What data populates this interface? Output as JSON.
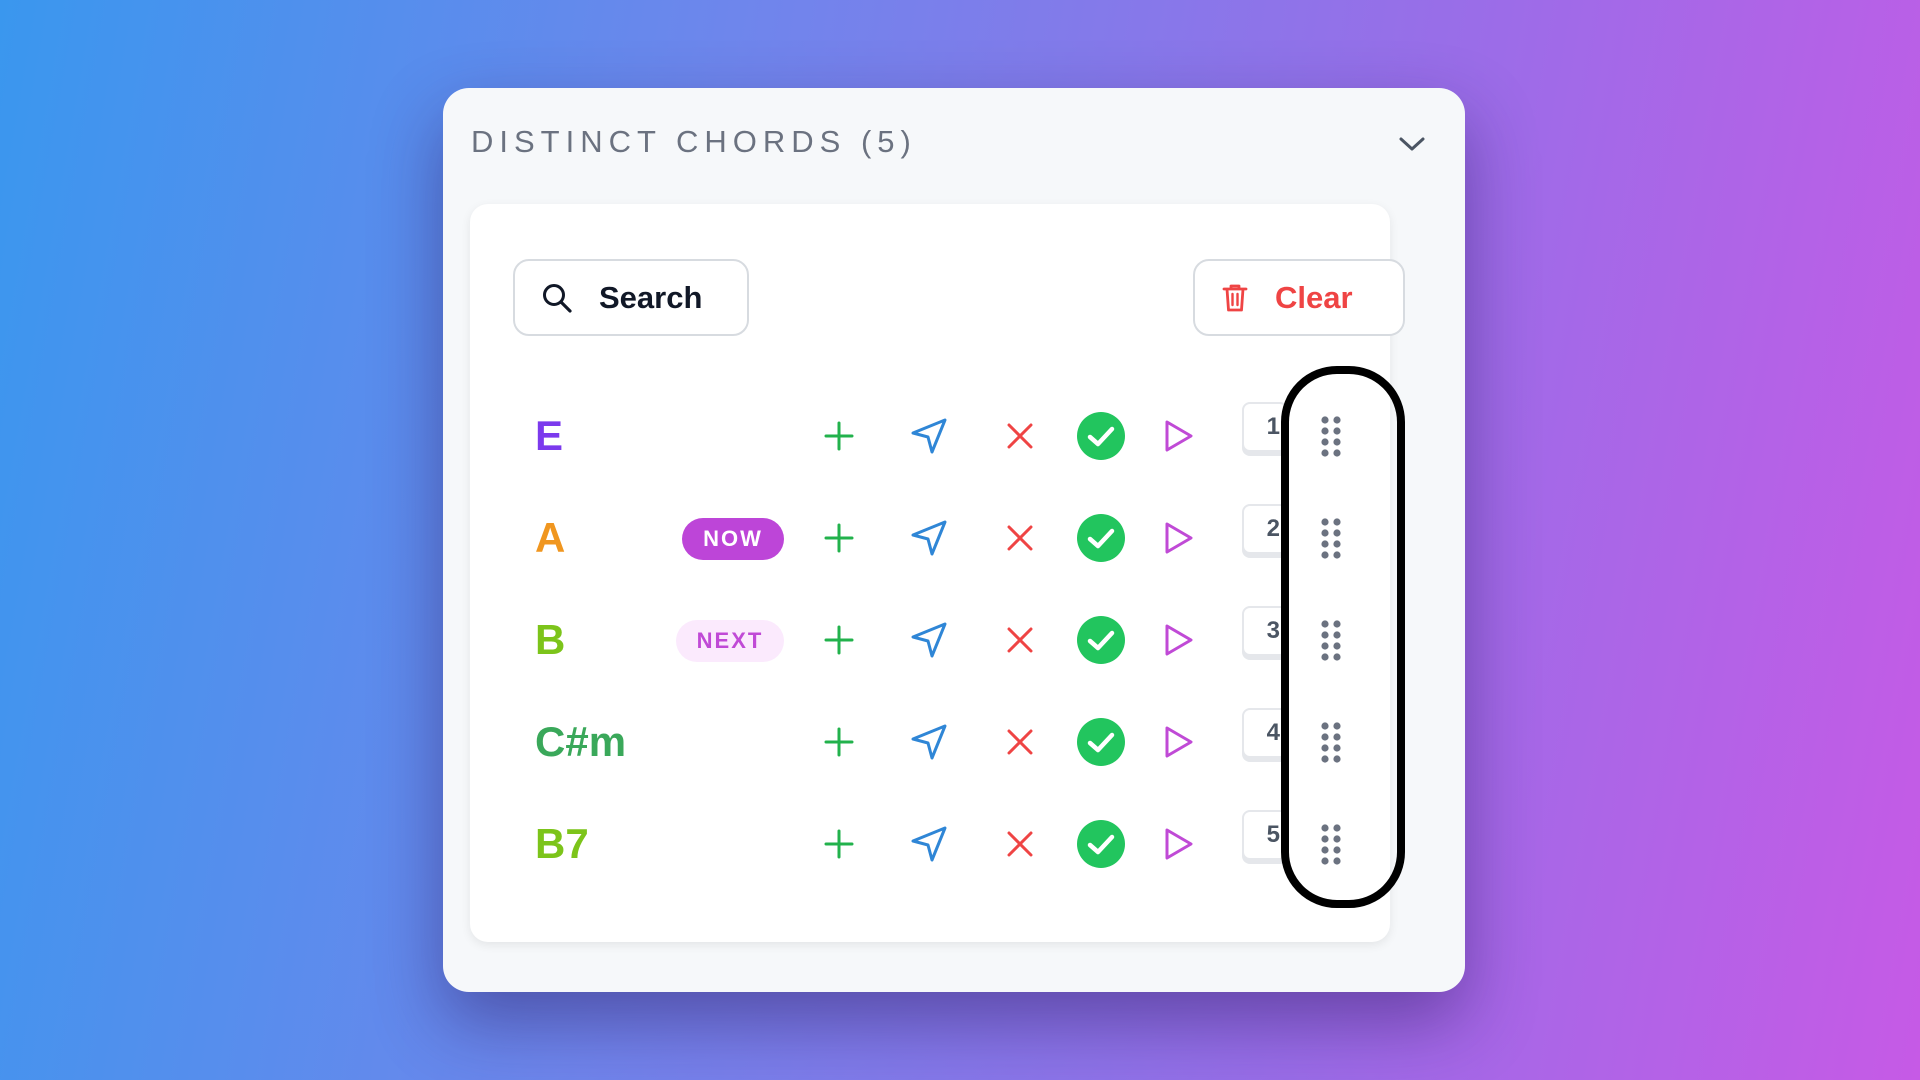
{
  "panel": {
    "title": "DISTINCT CHORDS (5)",
    "collapse_icon": "chevron-down-icon"
  },
  "toolbar": {
    "search_label": "Search",
    "search_icon": "search-icon",
    "clear_label": "Clear",
    "clear_icon": "trash-icon",
    "clear_color": "#ef4444"
  },
  "chords": [
    {
      "name": "E",
      "color": "#7c3aed",
      "badge": "",
      "badge_type": "",
      "order": "1"
    },
    {
      "name": "A",
      "color": "#f0961f",
      "badge": "NOW",
      "badge_type": "now",
      "order": "2"
    },
    {
      "name": "B",
      "color": "#7cc41a",
      "badge": "NEXT",
      "badge_type": "next",
      "order": "3"
    },
    {
      "name": "C#m",
      "color": "#3aa85a",
      "badge": "",
      "badge_type": "",
      "order": "4"
    },
    {
      "name": "B7",
      "color": "#7cc41a",
      "badge": "",
      "badge_type": "",
      "order": "5"
    }
  ],
  "row_actions": {
    "add_icon": "plus-icon",
    "send_icon": "send-icon",
    "remove_icon": "x-icon",
    "done_icon": "check-circle-icon",
    "play_icon": "play-icon",
    "drag_icon": "drag-handle-icon"
  },
  "colors": {
    "add": "#22b24c",
    "send": "#2f86d6",
    "remove": "#ef4444",
    "done": "#22c55e",
    "play": "#c04ad6",
    "badge_now_bg": "#bd45d8",
    "badge_next_bg": "#fbeafd"
  }
}
